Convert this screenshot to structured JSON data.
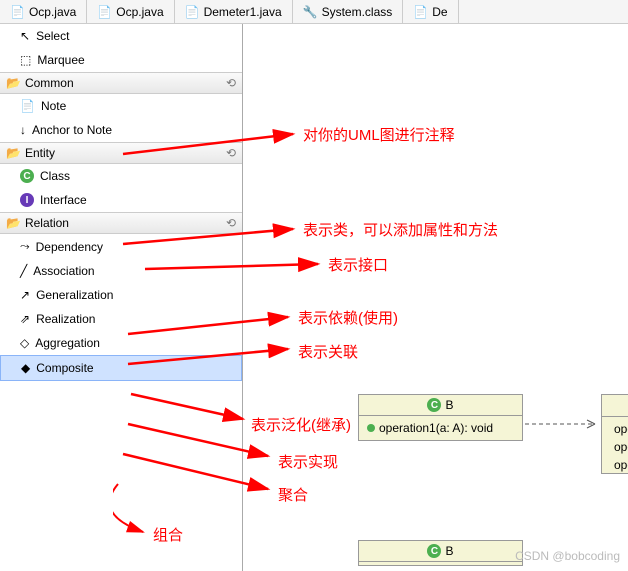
{
  "tabs": [
    {
      "label": "Ocp.java",
      "icon": "java"
    },
    {
      "label": "Ocp.java",
      "icon": "java"
    },
    {
      "label": "Demeter1.java",
      "icon": "java"
    },
    {
      "label": "System.class",
      "icon": "class"
    },
    {
      "label": "De",
      "icon": "java"
    }
  ],
  "palette": {
    "selection": [
      {
        "label": "Select",
        "icon": "cursor"
      },
      {
        "label": "Marquee",
        "icon": "marquee"
      }
    ],
    "groups": [
      {
        "name": "Common",
        "items": [
          {
            "label": "Note",
            "icon": "note"
          },
          {
            "label": "Anchor to Note",
            "icon": "anchor"
          }
        ]
      },
      {
        "name": "Entity",
        "items": [
          {
            "label": "Class",
            "icon": "class-circle"
          },
          {
            "label": "Interface",
            "icon": "interface-circle"
          }
        ]
      },
      {
        "name": "Relation",
        "items": [
          {
            "label": "Dependency",
            "icon": "dep"
          },
          {
            "label": "Association",
            "icon": "assoc"
          },
          {
            "label": "Generalization",
            "icon": "gen"
          },
          {
            "label": "Realization",
            "icon": "real"
          },
          {
            "label": "Aggregation",
            "icon": "agg"
          },
          {
            "label": "Composite",
            "icon": "comp",
            "selected": true
          }
        ]
      }
    ]
  },
  "annotations": {
    "note": "对你的UML图进行注释",
    "classA": "表示类，可以添加属性和方法",
    "interfaceA": "表示接口",
    "depA": "表示依赖(使用)",
    "assocA": "表示关联",
    "genA": "表示泛化(继承)",
    "realA": "表示实现",
    "aggA": "聚合",
    "compA": "组合"
  },
  "uml": {
    "box1": {
      "title": "B",
      "op": "operation1(a: A): void"
    },
    "box2": {
      "title": "B"
    },
    "sideOps": [
      "ope",
      "ope",
      "ope"
    ]
  },
  "watermark": "CSDN @bobcoding"
}
